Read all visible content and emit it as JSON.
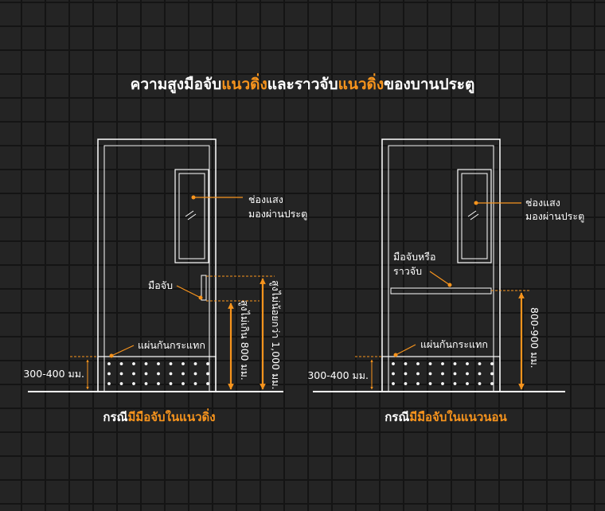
{
  "title": {
    "part1": "ความสูงมือจับ",
    "part2": "แนวดิ่ง",
    "part3": "และราวจับ",
    "part4": "แนวดิ่ง",
    "part5": "ของบานประตู"
  },
  "left_door": {
    "window_label_line1": "ช่องแสง",
    "window_label_line2": "มองผ่านประตู",
    "handle_label": "มือจับ",
    "kick_plate_label": "แผ่นกันกระแทก",
    "kick_plate_height": "300-400 มม.",
    "handle_height_min": "สูงไม่เกิน 800 มม.",
    "handle_height_max": "สูงไม่น้อยกว่า 1,000 มม.",
    "caption_part1": "กรณี",
    "caption_part2": "มีมือจับในแนวดิ่ง"
  },
  "right_door": {
    "window_label_line1": "ช่องแสง",
    "window_label_line2": "มองผ่านประตู",
    "handle_label_line1": "มือจับหรือ",
    "handle_label_line2": "ราวจับ",
    "kick_plate_label": "แผ่นกันกระแทก",
    "kick_plate_height": "300-400 มม.",
    "handle_height": "800-900 มม.",
    "caption_part1": "กรณี",
    "caption_part2": "มีมือจับในแนวนอน"
  },
  "colors": {
    "accent": "#f7941d",
    "line": "#ffffff",
    "background": "#242424"
  }
}
